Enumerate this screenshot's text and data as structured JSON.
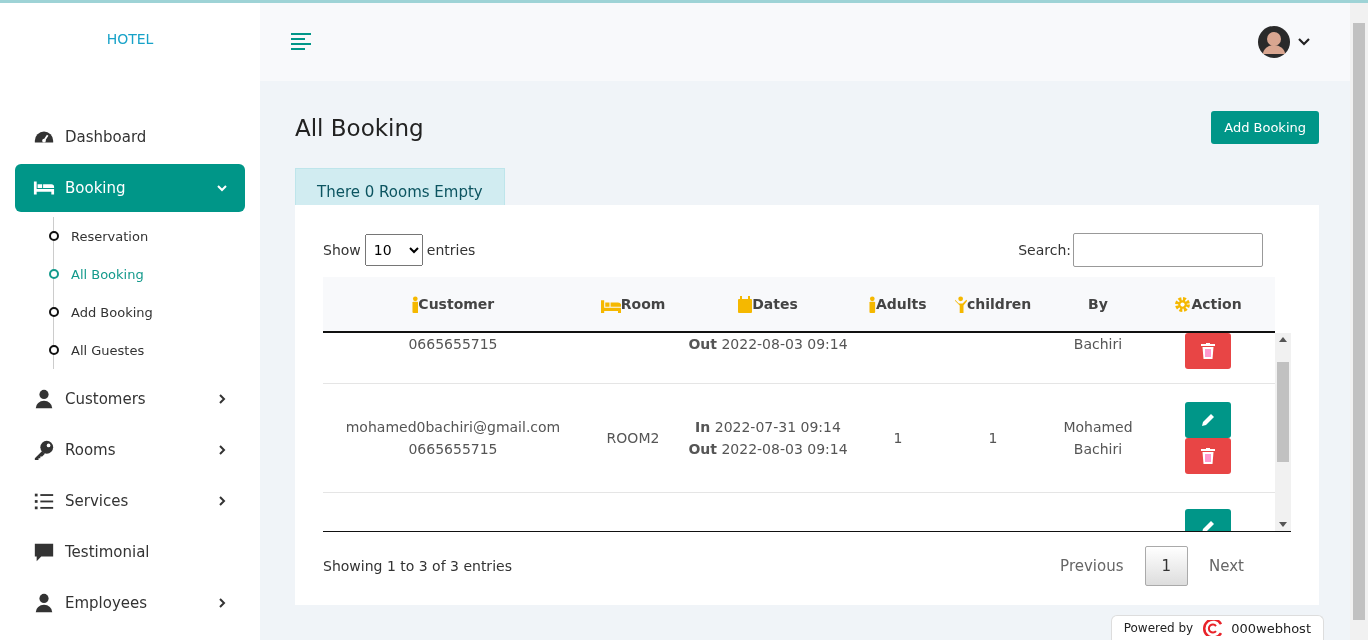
{
  "brand": "HOTEL",
  "sidebar": {
    "items": [
      {
        "label": "Dashboard",
        "selected": false
      },
      {
        "label": "Booking",
        "selected": true,
        "expanded": true,
        "children": [
          {
            "label": "Reservation",
            "selected": false
          },
          {
            "label": "All Booking",
            "selected": true
          },
          {
            "label": "Add Booking",
            "selected": false
          },
          {
            "label": "All Guestes",
            "selected": false
          }
        ]
      },
      {
        "label": "Customers",
        "selected": false,
        "expanded": false
      },
      {
        "label": "Rooms",
        "selected": false,
        "expanded": false
      },
      {
        "label": "Services",
        "selected": false,
        "expanded": false
      },
      {
        "label": "Testimonial",
        "selected": false
      },
      {
        "label": "Employees",
        "selected": false,
        "expanded": false
      }
    ]
  },
  "page": {
    "title": "All Booking",
    "add_button": "Add Booking",
    "notice": "There 0 Rooms Empty"
  },
  "table": {
    "show_label": "Show",
    "entries_value": "10",
    "entries_label": "entries",
    "search_label": "Search:",
    "columns": [
      {
        "label": "Customer"
      },
      {
        "label": "Room"
      },
      {
        "label": "Dates"
      },
      {
        "label": "Adults"
      },
      {
        "label": "children"
      },
      {
        "label": "By"
      },
      {
        "label": "Action"
      }
    ],
    "rows": [
      {
        "kind": "cut_top",
        "customer": [
          "0665655715"
        ],
        "room": "",
        "dates": [
          {
            "label": "Out",
            "value": "2022-08-03 09:14"
          }
        ],
        "adults": "",
        "children": "",
        "by": [
          "Bachiri"
        ],
        "actions": [
          {
            "kind": "delete"
          }
        ]
      },
      {
        "kind": "full",
        "customer": [
          "mohamed0bachiri@gmail.com",
          "0665655715"
        ],
        "room": "ROOM2",
        "dates": [
          {
            "label": "In",
            "value": "2022-07-31 09:14"
          },
          {
            "label": "Out",
            "value": "2022-08-03 09:14"
          }
        ],
        "adults": "1",
        "children": "1",
        "by": [
          "Mohamed",
          "Bachiri"
        ],
        "actions": [
          {
            "kind": "edit"
          },
          {
            "kind": "delete"
          }
        ]
      },
      {
        "kind": "cut_bottom",
        "customer": [],
        "room": "",
        "dates": [],
        "adults": "",
        "children": "",
        "by": [],
        "actions": [
          {
            "kind": "edit"
          }
        ]
      }
    ],
    "info": "Showing 1 to 3 of 3 entries",
    "pagination": [
      {
        "label": "Previous",
        "selected": false
      },
      {
        "label": "1",
        "selected": true
      },
      {
        "label": "Next",
        "selected": false
      }
    ]
  },
  "footer_badge": {
    "prefix": "Powered by",
    "brand": "000webhost"
  }
}
